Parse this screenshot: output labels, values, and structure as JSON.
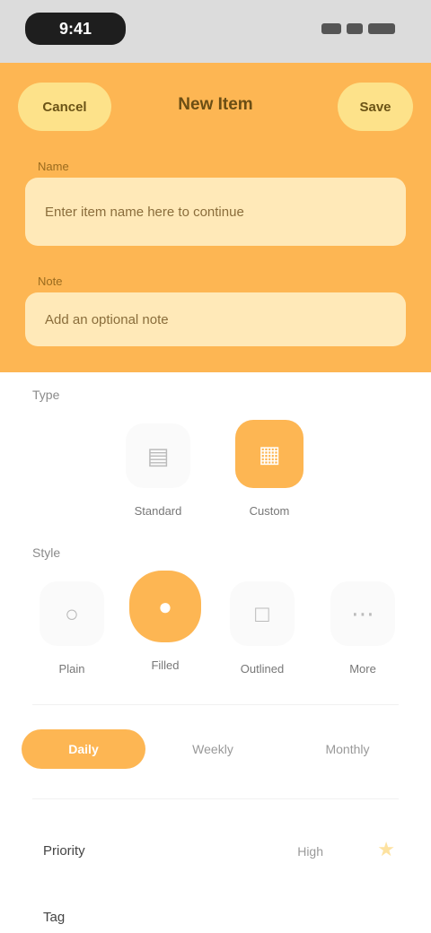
{
  "status_bar": {
    "time": "9:41",
    "icons": [
      "signal-icon",
      "wifi-icon",
      "battery-icon"
    ]
  },
  "header": {
    "back_label": "Cancel",
    "title": "New Item",
    "next_label": "Save",
    "field1": {
      "label": "Name",
      "value": "Enter item name here to continue"
    },
    "field2": {
      "label": "Note",
      "value": "Add an optional note"
    }
  },
  "section_type": {
    "title": "Type",
    "tiles": [
      {
        "icon": "document-icon",
        "label": "Standard",
        "selected": false
      },
      {
        "icon": "grid-icon",
        "label": "Custom",
        "selected": true
      }
    ]
  },
  "section_style": {
    "title": "Style",
    "tiles": [
      {
        "icon": "circle-icon",
        "label": "Plain",
        "selected": false
      },
      {
        "icon": "circle-filled-icon",
        "label": "Filled",
        "selected": true
      },
      {
        "icon": "square-icon",
        "label": "Outlined",
        "selected": false
      },
      {
        "icon": "dots-icon",
        "label": "More",
        "selected": false
      }
    ]
  },
  "segments": [
    "Daily",
    "Weekly",
    "Monthly"
  ],
  "active_segment": 0,
  "rows": [
    {
      "label": "Priority",
      "value": "High",
      "icon": "star-icon"
    },
    {
      "label": "Tag",
      "value": ""
    }
  ],
  "colors": {
    "accent": "#fdb653",
    "accent_light": "#ffe9b8",
    "pill": "#fde28a"
  }
}
